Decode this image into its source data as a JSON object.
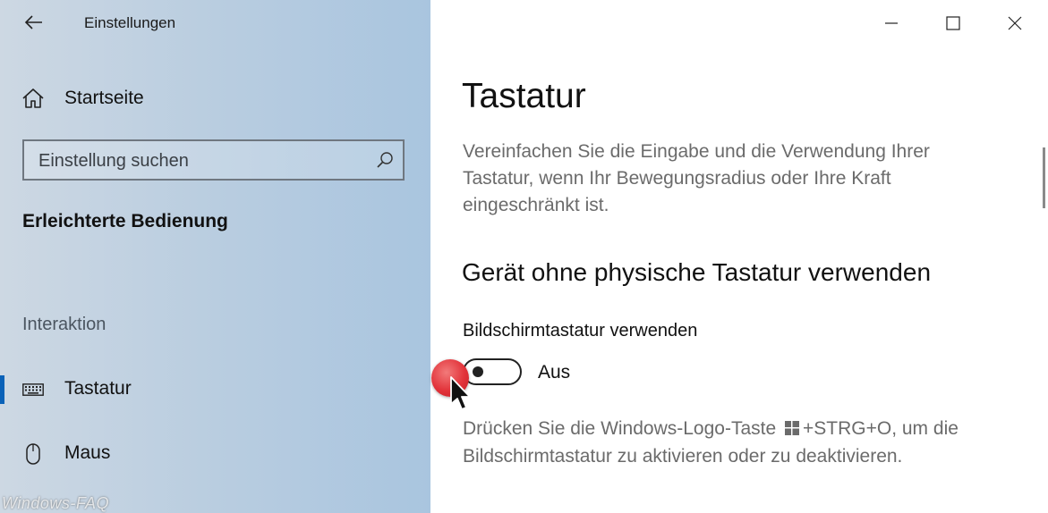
{
  "sidebar": {
    "app_title": "Einstellungen",
    "home_label": "Startseite",
    "search_placeholder": "Einstellung suchen",
    "category": "Erleichterte Bedienung",
    "group_header": "Interaktion",
    "items": [
      {
        "label": "Tastatur",
        "icon": "keyboard-icon",
        "active": true
      },
      {
        "label": "Maus",
        "icon": "mouse-icon",
        "active": false
      }
    ],
    "watermark": "Windows-FAQ"
  },
  "main": {
    "page_title": "Tastatur",
    "description": "Vereinfachen Sie die Eingabe und die Verwendung Ihrer Tastatur, wenn Ihr Bewegungsradius oder Ihre Kraft eingeschränkt ist.",
    "section_title": "Gerät ohne physische Tastatur verwenden",
    "setting_label": "Bildschirmtastatur verwenden",
    "toggle_state": "Aus",
    "toggle_on": false,
    "hint_before": "Drücken Sie die Windows-Logo-Taste",
    "hint_after": "+STRG+O, um die Bildschirmtastatur zu aktivieren oder zu deaktivieren."
  },
  "colors": {
    "accent": "#0a62b8",
    "click_highlight": "#e2333a"
  }
}
